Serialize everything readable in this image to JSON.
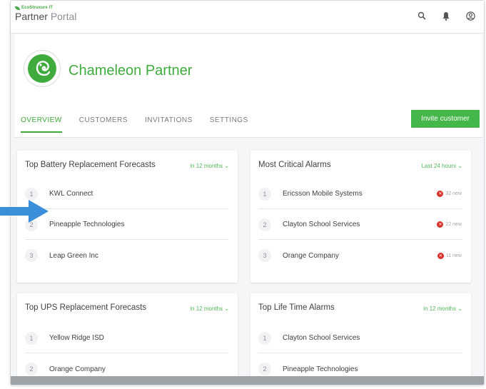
{
  "header": {
    "brand_small": "EcoStruxure IT",
    "brand_primary": "Partner",
    "brand_secondary": "Portal",
    "icons": [
      "search-icon",
      "bell-icon",
      "user-icon"
    ]
  },
  "partner": {
    "name": "Chameleon Partner"
  },
  "tabs": [
    {
      "label": "OVERVIEW",
      "active": true
    },
    {
      "label": "CUSTOMERS",
      "active": false
    },
    {
      "label": "INVITATIONS",
      "active": false
    },
    {
      "label": "SETTINGS",
      "active": false
    }
  ],
  "invite_button": "Invite customer",
  "cards": {
    "battery": {
      "title": "Top Battery Replacement Forecasts",
      "filter": "in 12 months ⌄",
      "rows": [
        {
          "rank": "1",
          "name": "KWL Connect"
        },
        {
          "rank": "2",
          "name": "Pineapple Technologies"
        },
        {
          "rank": "3",
          "name": "Leap Green Inc"
        }
      ]
    },
    "alarms": {
      "title": "Most Critical Alarms",
      "filter": "Last 24 hours ⌄",
      "rows": [
        {
          "rank": "1",
          "name": "Ericsson Mobile Systems",
          "badge": "32 new"
        },
        {
          "rank": "2",
          "name": "Clayton School Services",
          "badge": "22 new"
        },
        {
          "rank": "3",
          "name": "Orange Company",
          "badge": "11 new"
        }
      ]
    },
    "ups": {
      "title": "Top UPS Replacement Forecasts",
      "filter": "in 12 months ⌄",
      "rows": [
        {
          "rank": "1",
          "name": "Yellow Ridge ISD"
        },
        {
          "rank": "2",
          "name": "Orange Company"
        }
      ]
    },
    "lifetime": {
      "title": "Top Life Time Alarms",
      "filter": "in 12 months ⌄",
      "rows": [
        {
          "rank": "1",
          "name": "Clayton School Services"
        },
        {
          "rank": "2",
          "name": "Pineapple Technologies"
        }
      ]
    }
  },
  "colors": {
    "accent": "#3fab3c",
    "button": "#45b649",
    "alarm": "#d9322b",
    "pointer": "#3a8fd8"
  }
}
